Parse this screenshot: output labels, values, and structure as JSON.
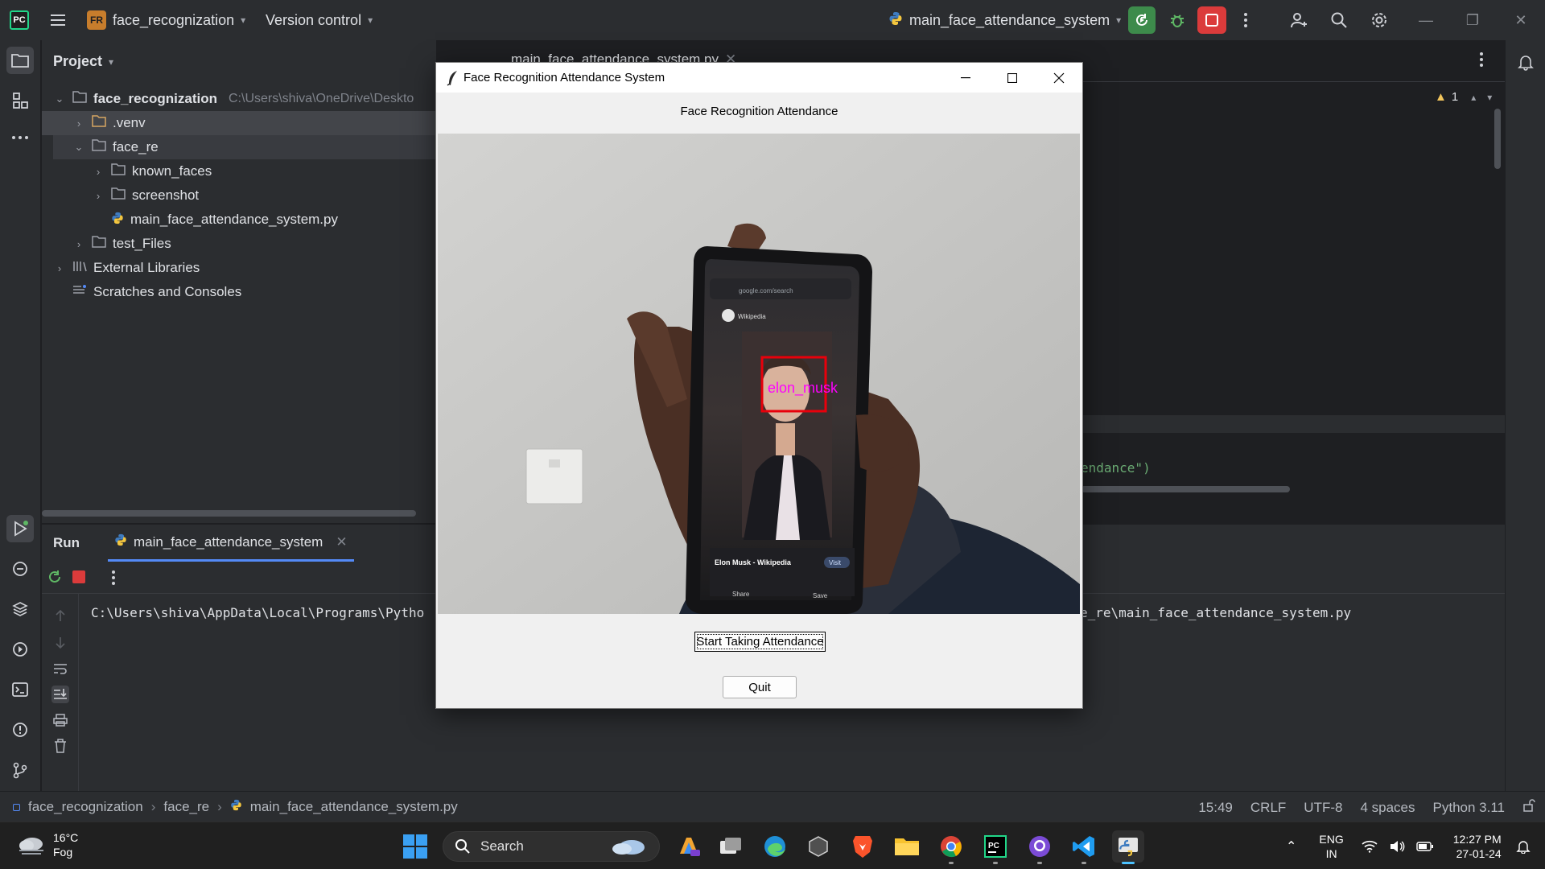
{
  "ide": {
    "project_badge": "FR",
    "project_name": "face_recognization",
    "vcs_label": "Version control",
    "run_config": "main_face_attendance_system",
    "notifications_count": "1"
  },
  "project_panel": {
    "header": "Project",
    "root": {
      "label": "face_recognization",
      "path": "C:\\Users\\shiva\\OneDrive\\Deskto"
    },
    "items": [
      {
        "label": ".venv"
      },
      {
        "label": "face_re"
      },
      {
        "label": "known_faces"
      },
      {
        "label": "screenshot"
      },
      {
        "label": "main_face_attendance_system.py"
      },
      {
        "label": "test_Files"
      },
      {
        "label": "External Libraries"
      },
      {
        "label": "Scratches and Consoles"
      }
    ]
  },
  "editor": {
    "tab_label": "main_face_attendance_system.py",
    "warning_count": "1",
    "code_fragment": "endance\")"
  },
  "run_panel": {
    "title": "Run",
    "tab_label": "main_face_attendance_system",
    "output_head": "C:\\Users\\shiva\\AppData\\Local\\Programs\\Pytho",
    "output_tail": "e_re\\main_face_attendance_system.py"
  },
  "statusbar": {
    "crumbs": [
      "face_recognization",
      "face_re",
      "main_face_attendance_system.py"
    ],
    "position": "15:49",
    "line_sep": "CRLF",
    "encoding": "UTF-8",
    "indent": "4 spaces",
    "interpreter": "Python 3.11"
  },
  "dialog": {
    "title": "Face Recognition Attendance System",
    "heading": "Face Recognition Attendance",
    "face_label": "elon_musk",
    "start_button": "Start Taking Attendance",
    "quit_button": "Quit",
    "phone_text": {
      "result_title": "Elon Musk - Wikipedia",
      "visit": "Visit",
      "share": "Share",
      "save": "Save",
      "site": "Wikipedia",
      "url": "google.com/search"
    }
  },
  "taskbar": {
    "temperature": "16°C",
    "weather": "Fog",
    "search_placeholder": "Search",
    "lang_top": "ENG",
    "lang_bottom": "IN",
    "time": "12:27 PM",
    "date": "27-01-24"
  },
  "colors": {
    "accent": "#548af7",
    "rerun_green": "#3d8b4b",
    "stop_red": "#db3b3b",
    "face_box": "#e8000b",
    "face_text": "#ff00ff"
  }
}
